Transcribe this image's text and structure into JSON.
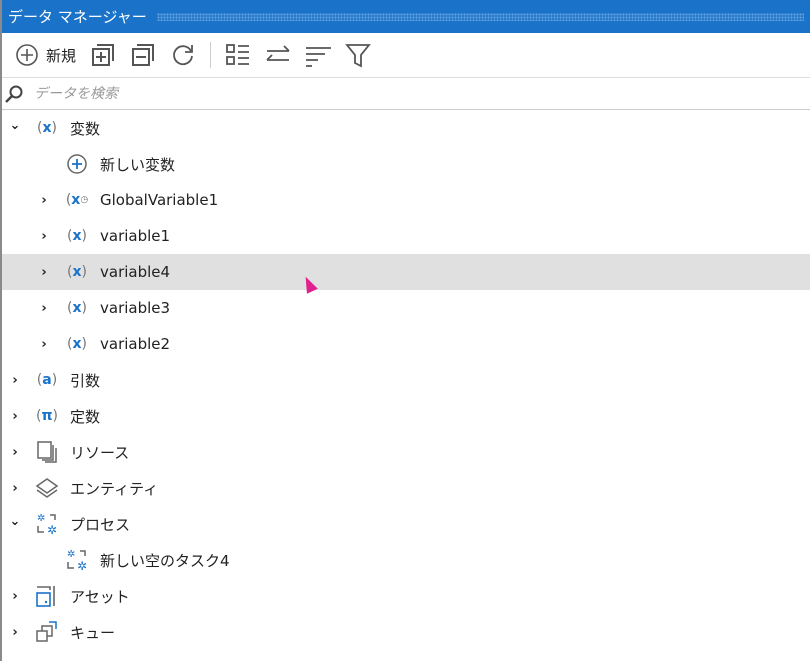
{
  "title": "データ マネージャー",
  "toolbar": {
    "new_label": "新規",
    "icons": [
      "plus-circle-icon",
      "expand-all-icon",
      "collapse-all-icon",
      "refresh-icon",
      "list-view-icon",
      "swap-icon",
      "sort-icon",
      "filter-icon"
    ]
  },
  "search": {
    "placeholder": "データを検索"
  },
  "tree": [
    {
      "label": "変数",
      "level": 0,
      "chev": "down",
      "icon": "variable-icon"
    },
    {
      "label": "新しい変数",
      "level": 1,
      "chev": "",
      "icon": "add-icon"
    },
    {
      "label": "GlobalVariable1",
      "level": 1,
      "chev": "right",
      "icon": "global-variable-icon"
    },
    {
      "label": "variable1",
      "level": 1,
      "chev": "right",
      "icon": "variable-icon"
    },
    {
      "label": "variable4",
      "level": 1,
      "chev": "right",
      "icon": "variable-icon",
      "selected": true
    },
    {
      "label": "variable3",
      "level": 1,
      "chev": "right",
      "icon": "variable-icon"
    },
    {
      "label": "variable2",
      "level": 1,
      "chev": "right",
      "icon": "variable-icon"
    },
    {
      "label": "引数",
      "level": 0,
      "chev": "right",
      "icon": "argument-icon"
    },
    {
      "label": "定数",
      "level": 0,
      "chev": "right",
      "icon": "constant-icon"
    },
    {
      "label": "リソース",
      "level": 0,
      "chev": "right",
      "icon": "resources-icon"
    },
    {
      "label": "エンティティ",
      "level": 0,
      "chev": "right",
      "icon": "entities-icon"
    },
    {
      "label": "プロセス",
      "level": 0,
      "chev": "down",
      "icon": "process-icon"
    },
    {
      "label": "新しい空のタスク4",
      "level": 1,
      "chev": "",
      "icon": "process-icon"
    },
    {
      "label": "アセット",
      "level": 0,
      "chev": "right",
      "icon": "asset-icon"
    },
    {
      "label": "キュー",
      "level": 0,
      "chev": "right",
      "icon": "queue-icon"
    }
  ],
  "colors": {
    "accent": "#1b73c9",
    "selection": "#e0e0e0"
  }
}
